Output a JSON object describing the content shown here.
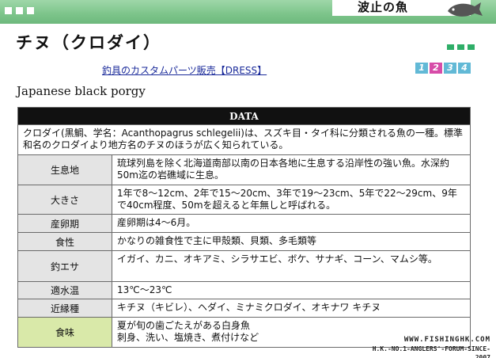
{
  "header": {
    "page_label": "波止の魚"
  },
  "fish": {
    "title": "チヌ（クロダイ）",
    "english_name": "Japanese black porgy"
  },
  "shop_link": "釣具のカスタムパーツ販売【DRESS】",
  "pager": [
    {
      "label": "1",
      "color": "#62b9d6"
    },
    {
      "label": "2",
      "color": "#d74ca8"
    },
    {
      "label": "3",
      "color": "#62b9d6"
    },
    {
      "label": "4",
      "color": "#62b9d6"
    }
  ],
  "table": {
    "header": "DATA",
    "intro": "クロダイ(黒鯛、学名：Acanthopagrus schlegelii)は、スズキ目・タイ科に分類される魚の一種。標準和名のクロダイより地方名のチヌのほうが広く知られている。",
    "rows": [
      {
        "label": "生息地",
        "value": "琉球列島を除く北海道南部以南の日本各地に生息する沿岸性の強い魚。水深約50m迄の岩礁域に生息。"
      },
      {
        "label": "大きさ",
        "value": "1年で8～12cm、2年で15～20cm、3年で19～23cm、5年で22～29cm、9年で40cm程度、50mを超えると年無しと呼ばれる。"
      },
      {
        "label": "産卵期",
        "value": "産卵期は4～6月。"
      },
      {
        "label": "食性",
        "value": "かなりの雑食性で主に甲殻類、貝類、多毛類等"
      },
      {
        "label": "釣エサ",
        "value": "イガイ、カニ、オキアミ、シラサエビ、ボケ、サナギ、コーン、マムシ等。"
      },
      {
        "label": "適水温",
        "value": "13℃～23℃"
      },
      {
        "label": "近縁種",
        "value": "キチヌ（キビレ）、ヘダイ、ミナミクロダイ、オキナワ キチヌ"
      },
      {
        "label": "食味",
        "value": "夏が旬の歯ごたえがある白身魚\n刺身、洗い、塩焼き、煮付けなど"
      }
    ]
  },
  "watermark": {
    "line1": "WWW.FISHINGHK.COM",
    "line2": "H.K.-NO.1-ANGLERS'-FORUM-SINCE-2007"
  }
}
